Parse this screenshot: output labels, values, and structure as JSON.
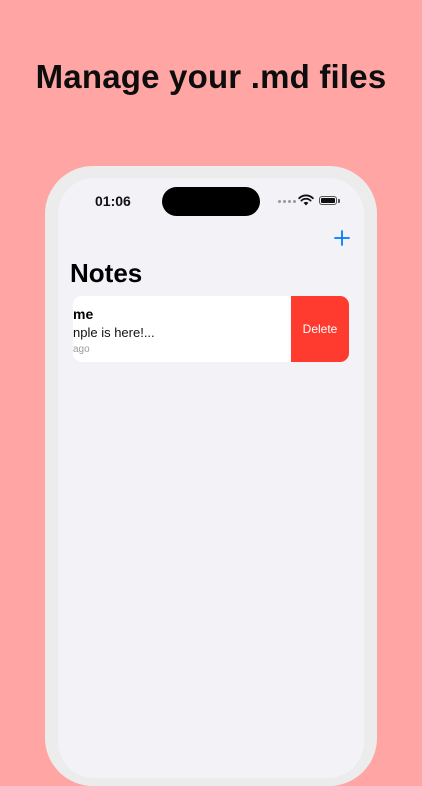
{
  "promo": {
    "headline": "Manage your .md files"
  },
  "status_bar": {
    "time": "01:06",
    "icons": [
      "signal-icon",
      "wifi-icon",
      "battery-icon"
    ]
  },
  "nav": {
    "add_icon": "plus-icon",
    "accent_color": "#007AFF"
  },
  "screen": {
    "title": "Notes"
  },
  "notes": [
    {
      "title_visible": "me",
      "preview_visible": "nple is here!...",
      "time_visible": "ago"
    }
  ],
  "swipe_action": {
    "label": "Delete",
    "color": "#FF3B30"
  },
  "colors": {
    "background": "#FFA6A5",
    "screen": "#F2F2F7"
  }
}
